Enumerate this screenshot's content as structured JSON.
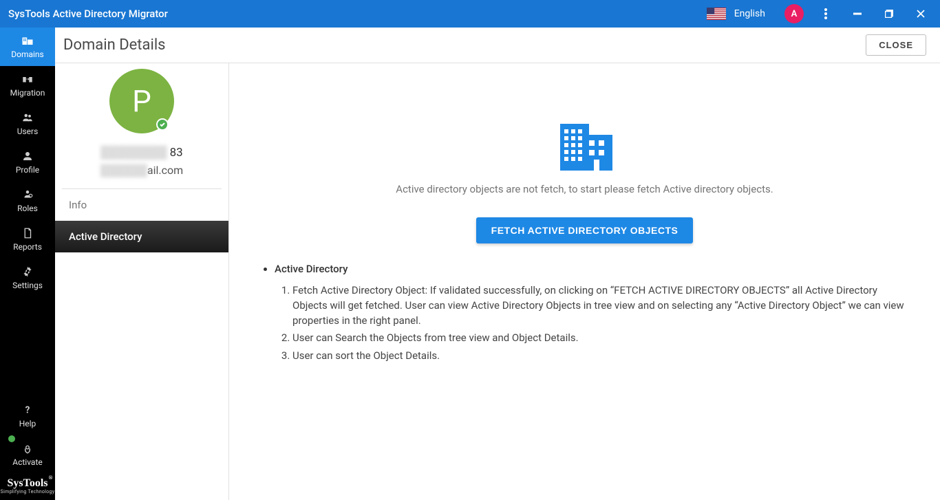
{
  "titlebar": {
    "title": "SysTools Active Directory Migrator",
    "language": "English",
    "avatar_letter": "A"
  },
  "sidebar": {
    "items": [
      {
        "label": "Domains"
      },
      {
        "label": "Migration"
      },
      {
        "label": "Users"
      },
      {
        "label": "Profile"
      },
      {
        "label": "Roles"
      },
      {
        "label": "Reports"
      },
      {
        "label": "Settings"
      }
    ],
    "help": "Help",
    "activate": "Activate",
    "brand": "SysTools",
    "brand_sub": "Simplifying Technology"
  },
  "header": {
    "title": "Domain Details",
    "close": "CLOSE"
  },
  "profile": {
    "initial": "P",
    "line1_suffix": "83",
    "line2_suffix": "ail.com"
  },
  "tabs": {
    "info": "Info",
    "ad": "Active Directory"
  },
  "right": {
    "empty_text": "Active directory objects are not fetch, to start please fetch Active directory objects.",
    "fetch_btn": "FETCH ACTIVE DIRECTORY OBJECTS",
    "heading": "Active Directory",
    "steps": [
      "Fetch Active Directory Object: If validated successfully, on clicking on “FETCH ACTIVE DIRECTORY OBJECTS” all Active Directory Objects will get fetched. User can view Active Directory Objects in tree view and on selecting any “Active Directory Object” we can view properties in the right panel.",
      "User can Search the Objects from tree view and Object Details.",
      "User can sort the Object Details."
    ]
  }
}
